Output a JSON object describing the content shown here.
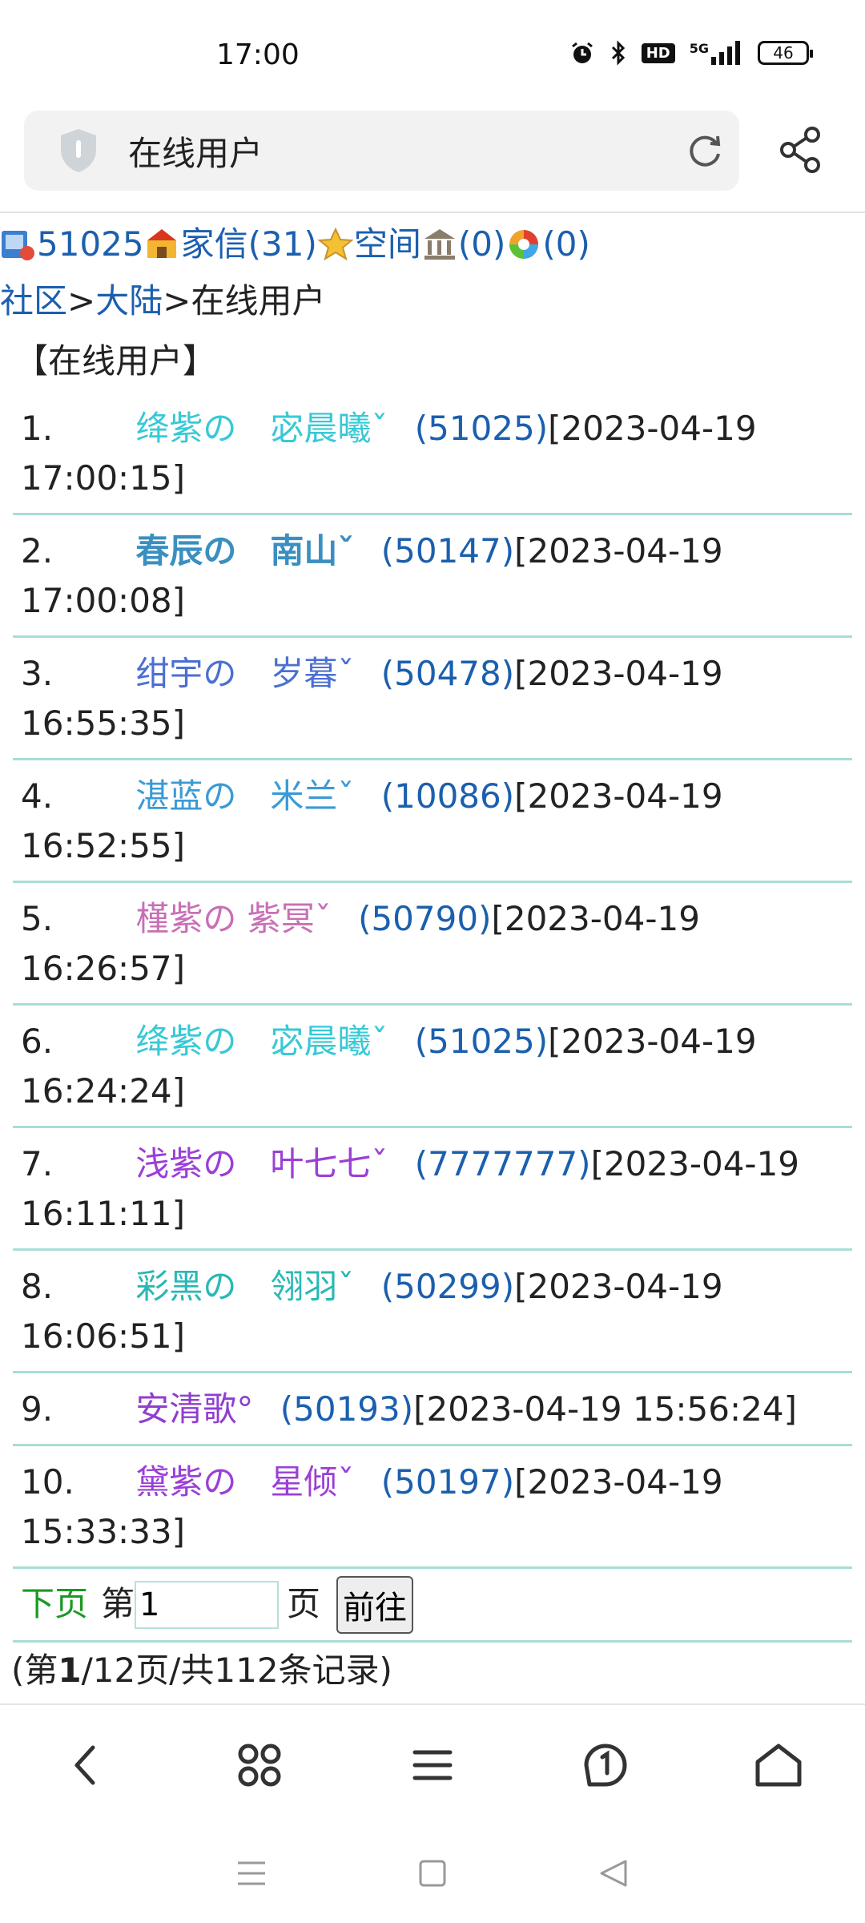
{
  "status_bar": {
    "time": "17:00",
    "network": "5G",
    "hd": "HD",
    "battery": "46",
    "icons": [
      "alarm-icon",
      "bluetooth-icon",
      "hd-icon",
      "signal-icon",
      "battery-icon"
    ]
  },
  "address_bar": {
    "title": "在线用户"
  },
  "topline": {
    "user_id": "51025",
    "mail_label": "家信(31)",
    "space_label": "空间",
    "bank_count": "(0)",
    "other_count": "(0)"
  },
  "breadcrumb": {
    "community": "社区",
    "sep1": ">",
    "region": "大陆",
    "sep2": ">",
    "current": "在线用户"
  },
  "section_title": "【在线用户】",
  "users": [
    {
      "num": "1.",
      "nick": "绛紫の　宓晨曦ˇ",
      "id": "(51025)",
      "time": "[2023-04-19 17:00:15]"
    },
    {
      "num": "2.",
      "nick": "春辰の　南山ˇ",
      "id": "(50147)",
      "time": "[2023-04-19 17:00:08]"
    },
    {
      "num": "3.",
      "nick": "绀宇の　岁暮ˇ",
      "id": "(50478)",
      "time": "[2023-04-19 16:55:35]"
    },
    {
      "num": "4.",
      "nick": "湛蓝の　米兰ˇ",
      "id": "(10086)",
      "time": "[2023-04-19 16:52:55]"
    },
    {
      "num": "5.",
      "nick": "槿紫の 紫冥ˇ",
      "id": "(50790)",
      "time": "[2023-04-19 16:26:57]"
    },
    {
      "num": "6.",
      "nick": "绛紫の　宓晨曦ˇ",
      "id": "(51025)",
      "time": "[2023-04-19 16:24:24]"
    },
    {
      "num": "7.",
      "nick": "浅紫の　叶七七ˇ",
      "id": "(7777777)",
      "time": "[2023-04-19 16:11:11]"
    },
    {
      "num": "8.",
      "nick": "彩黑の　翎羽ˇ",
      "id": "(50299)",
      "time": "[2023-04-19 16:06:51]"
    },
    {
      "num": "9.",
      "nick": "安清歌°",
      "id": "(50193)",
      "time": "[2023-04-19 15:56:24]"
    },
    {
      "num": "10.",
      "nick": "黛紫の　星倾ˇ",
      "id": "(50197)",
      "time": "[2023-04-19 15:33:33]"
    }
  ],
  "pager": {
    "next_label": "下页",
    "page_prefix": "第",
    "page_value": "1",
    "page_suffix": "页",
    "go_label": "前往",
    "records_prefix": "(第",
    "records_current": "1",
    "records_suffix": "/12页/共112条记录)"
  },
  "colors": {
    "link": "#1b5fae",
    "next_link": "#1a9a22",
    "row_border": "#a9ddd5"
  }
}
